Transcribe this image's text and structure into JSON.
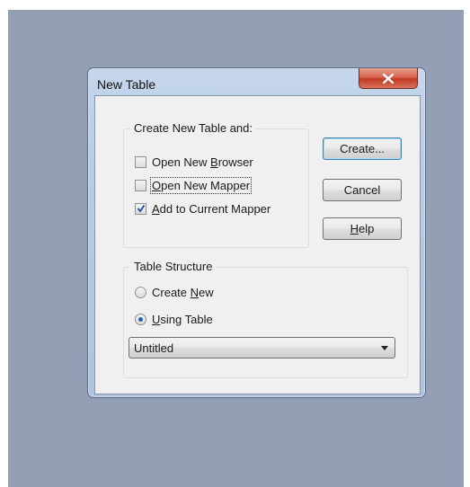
{
  "window": {
    "title": "New Table",
    "close_icon": "close-icon"
  },
  "create_group": {
    "label": "Create New Table and:",
    "options": [
      {
        "pre": "Open New ",
        "key": "B",
        "post": "rowser",
        "checked": false
      },
      {
        "pre": "",
        "key": "O",
        "post": "pen New Mapper",
        "checked": false
      },
      {
        "pre": "",
        "key": "A",
        "post": "dd to Current Mapper",
        "checked": true
      }
    ]
  },
  "buttons": {
    "create": "Create...",
    "cancel": "Cancel",
    "help_key": "H",
    "help_rest": "elp"
  },
  "structure_group": {
    "label": "Table Structure",
    "options": [
      {
        "pre": "Create ",
        "key": "N",
        "post": "ew",
        "selected": false
      },
      {
        "pre": "",
        "key": "U",
        "post": "sing Table",
        "selected": true
      }
    ]
  },
  "table_select": {
    "value": "Untitled"
  }
}
